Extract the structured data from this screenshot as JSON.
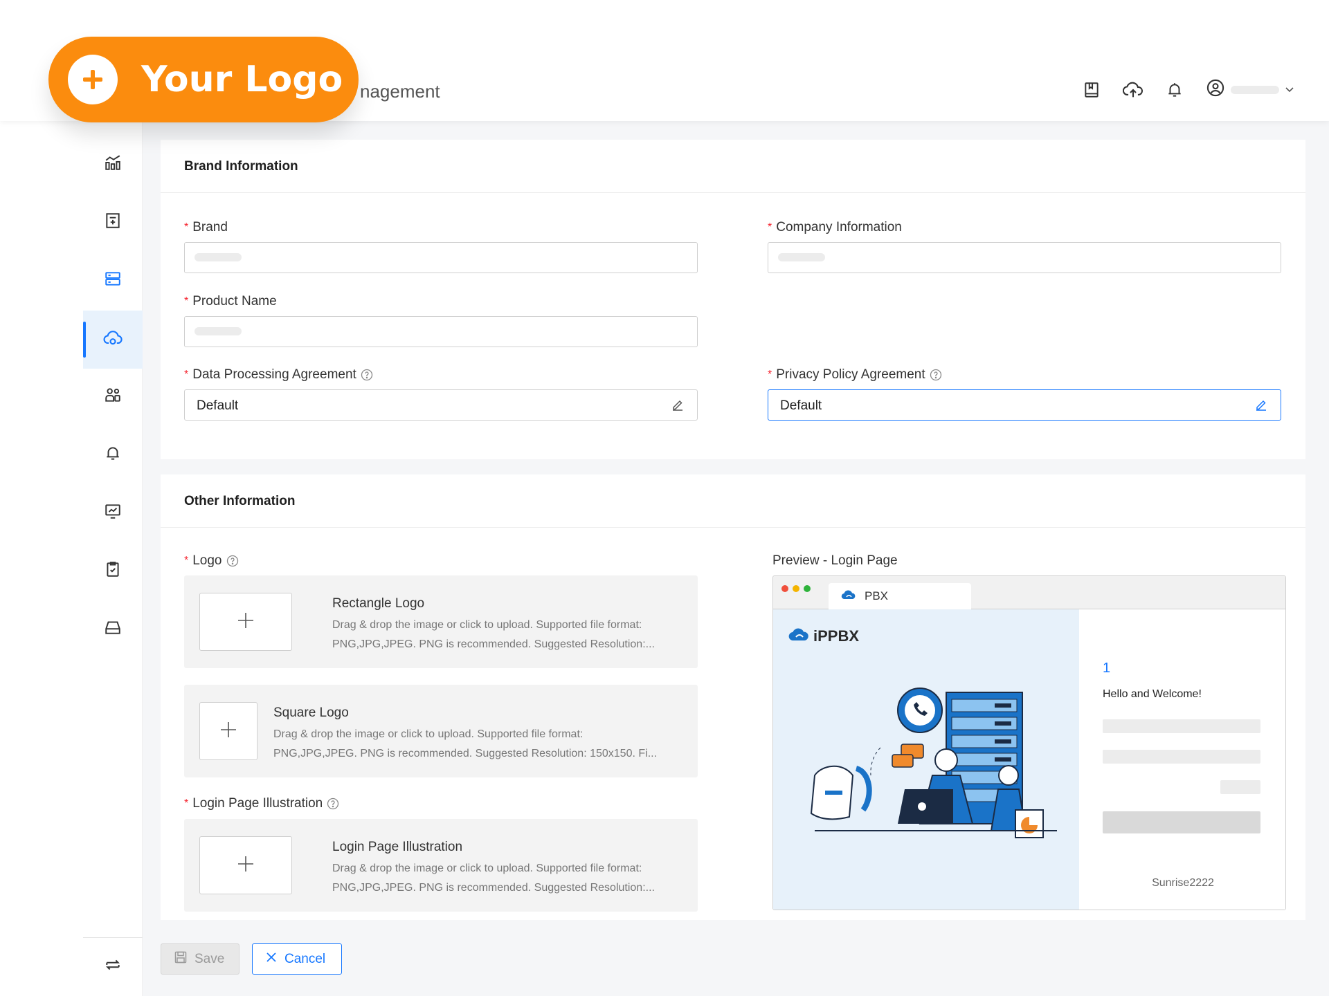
{
  "logo_badge": {
    "text": "Your Logo"
  },
  "header": {
    "title_partial": "nagement"
  },
  "brand_section": {
    "title": "Brand Information",
    "brand_label": "Brand",
    "company_label": "Company Information",
    "product_label": "Product Name",
    "dpa_label": "Data Processing Agreement",
    "dpa_value": "Default",
    "privacy_label": "Privacy Policy Agreement",
    "privacy_value": "Default"
  },
  "other_section": {
    "title": "Other Information",
    "logo_label": "Logo",
    "rect_logo": {
      "title": "Rectangle Logo",
      "desc1": "Drag & drop the image or click to upload. Supported file format:",
      "desc2": "PNG,JPG,JPEG. PNG is recommended. Suggested Resolution:..."
    },
    "square_logo": {
      "title": "Square Logo",
      "desc1": "Drag & drop the image or click to upload. Supported file format:",
      "desc2": "PNG,JPG,JPEG. PNG is recommended. Suggested Resolution: 150x150. Fi..."
    },
    "illustration_label": "Login Page Illustration",
    "illustration": {
      "title": "Login Page Illustration",
      "desc1": "Drag & drop the image or click to upload. Supported file format:",
      "desc2": "PNG,JPG,JPEG. PNG is recommended. Suggested Resolution:..."
    }
  },
  "preview": {
    "label": "Preview - Login Page",
    "tab_label": "PBX",
    "brand_name": "iPPBX",
    "step_number": "1",
    "welcome": "Hello and Welcome!",
    "footer": "Sunrise2222"
  },
  "buttons": {
    "save": "Save",
    "cancel": "Cancel"
  },
  "colors": {
    "accent": "#1677ff",
    "required": "#f5222d",
    "logo_orange": "#fb8c0e"
  },
  "icons": {
    "header": [
      "book-icon",
      "cloud-upload-icon",
      "bell-icon",
      "user-circle-icon",
      "chevron-down-icon"
    ],
    "sidebar": [
      "dashboard-icon",
      "bookmark-icon",
      "server-icon",
      "cloud-service-icon",
      "users-icon",
      "bell-icon",
      "monitor-chart-icon",
      "clipboard-check-icon",
      "storage-icon",
      "switch-icon"
    ]
  }
}
